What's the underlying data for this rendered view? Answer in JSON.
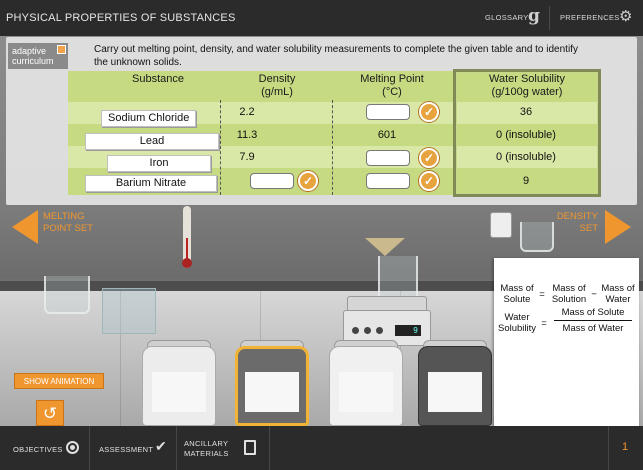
{
  "app": {
    "title": "PHYSICAL PROPERTIES OF SUBSTANCES",
    "glossary_label": "GLOSSARY",
    "glossary_icon": "g",
    "preferences_label": "PREFERENCES"
  },
  "logo": {
    "line1": "adaptive",
    "line2": "curriculum"
  },
  "instructions": "Carry out melting point, density, and water solubility measurements to complete the given table and to identify the unknown solids.",
  "table": {
    "headers": {
      "substance": "Substance",
      "density": "Density",
      "density_unit": "(g/mL)",
      "melting": "Melting Point",
      "melting_unit": "(°C)",
      "solubility": "Water Solubility",
      "solubility_unit": "(g/100g water)"
    },
    "rows": [
      {
        "substance": "Sodium Chloride",
        "density": "2.2",
        "melting": "",
        "solubility": "36"
      },
      {
        "substance": "Lead",
        "density": "11.3",
        "melting": "601",
        "solubility": "0 (insoluble)"
      },
      {
        "substance": "Iron",
        "density": "7.9",
        "melting": "",
        "solubility": "0 (insoluble)"
      },
      {
        "substance": "Barium Nitrate",
        "density": "",
        "melting": "",
        "solubility": "9"
      }
    ],
    "check_symbol": "✓"
  },
  "nav": {
    "prev_label": "MELTING POINT SET",
    "next_label": "DENSITY SET"
  },
  "balance_reading": "9",
  "equations": {
    "mass_of": "Mass of",
    "solute": "Solute",
    "eq_sign": "=",
    "minus_sign": "−",
    "mass_of_solution_1": "Mass of",
    "mass_of_solution_2": "Solution",
    "mass_of_water_1": "Mass of",
    "mass_of_water_2": "Water",
    "water": "Water",
    "solubility": "Solubility",
    "numerator": "Mass of Solute",
    "denominator": "Mass of Water"
  },
  "buttons": {
    "show_animation": "SHOW ANIMATION",
    "reset_icon": "↺"
  },
  "bottom": {
    "objectives": "OBJECTIVES",
    "assessment": "ASSESSMENT",
    "ancillary_1": "ANCILLARY",
    "ancillary_2": "MATERIALS",
    "page": "1"
  },
  "colors": {
    "accent": "#f0962e",
    "table_green": "#c6da82",
    "bar": "#2b2b2b"
  }
}
